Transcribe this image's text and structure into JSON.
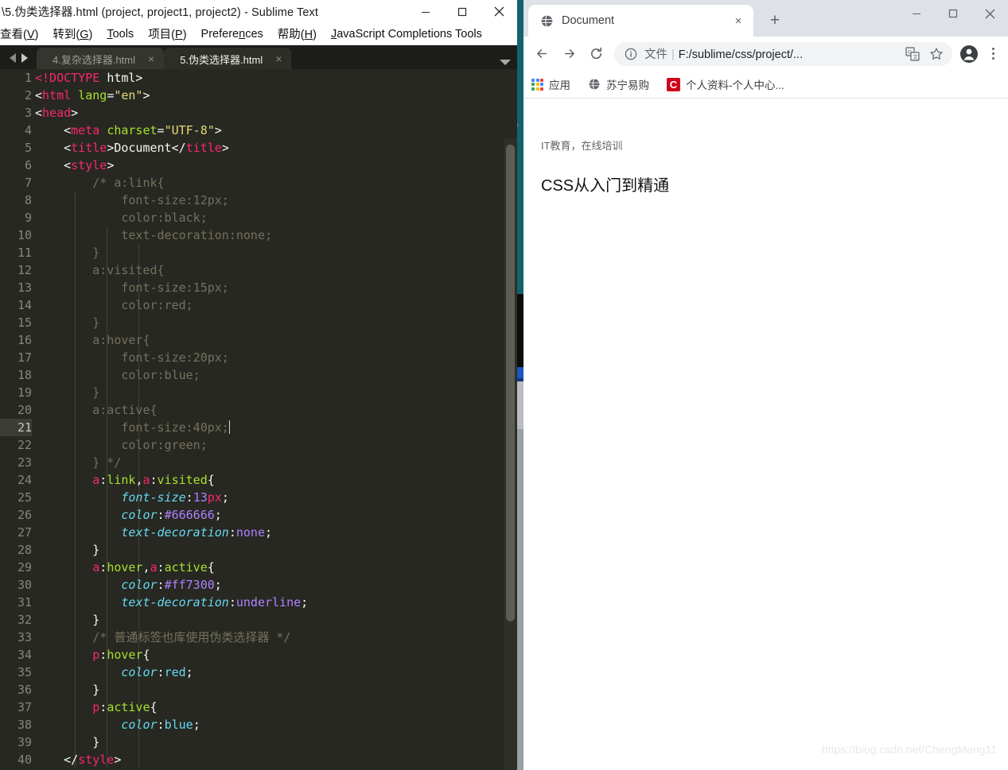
{
  "sublime": {
    "title": "\\5.伪类选择器.html (project, project1, project2) - Sublime Text",
    "window_buttons": {
      "minimize": "minimize-icon",
      "maximize": "maximize-icon",
      "close": "close-icon"
    },
    "menus": [
      {
        "label": "查看(V)",
        "mnemonic": "V"
      },
      {
        "label": "转到(G)",
        "mnemonic": "G"
      },
      {
        "label": "Tools",
        "mnemonic": "T"
      },
      {
        "label": "项目(P)",
        "mnemonic": "P"
      },
      {
        "label": "Preferences",
        "mnemonic": "n"
      },
      {
        "label": "帮助(H)",
        "mnemonic": "H"
      },
      {
        "label": "JavaScript Completions Tools",
        "mnemonic": "J"
      }
    ],
    "tabs": [
      {
        "label": "4.复杂选择器.html",
        "active": false,
        "close": "×"
      },
      {
        "label": "5.伪类选择器.html",
        "active": true,
        "close": "×"
      }
    ],
    "current_line": 21,
    "code_lines": [
      {
        "n": 1,
        "text": "<!DOCTYPE html>"
      },
      {
        "n": 2,
        "text": "<html lang=\"en\">"
      },
      {
        "n": 3,
        "text": "<head>"
      },
      {
        "n": 4,
        "text": "    <meta charset=\"UTF-8\">"
      },
      {
        "n": 5,
        "text": "    <title>Document</title>"
      },
      {
        "n": 6,
        "text": "    <style>"
      },
      {
        "n": 7,
        "text": "        /* a:link{"
      },
      {
        "n": 8,
        "text": "            font-size:12px;"
      },
      {
        "n": 9,
        "text": "            color:black;"
      },
      {
        "n": 10,
        "text": "            text-decoration:none;"
      },
      {
        "n": 11,
        "text": "        }"
      },
      {
        "n": 12,
        "text": "        a:visited{"
      },
      {
        "n": 13,
        "text": "            font-size:15px;"
      },
      {
        "n": 14,
        "text": "            color:red;"
      },
      {
        "n": 15,
        "text": "        }"
      },
      {
        "n": 16,
        "text": "        a:hover{"
      },
      {
        "n": 17,
        "text": "            font-size:20px;"
      },
      {
        "n": 18,
        "text": "            color:blue;"
      },
      {
        "n": 19,
        "text": "        }"
      },
      {
        "n": 20,
        "text": "        a:active{"
      },
      {
        "n": 21,
        "text": "            font-size:40px;"
      },
      {
        "n": 22,
        "text": "            color:green;"
      },
      {
        "n": 23,
        "text": "        } */"
      },
      {
        "n": 24,
        "text": "        a:link,a:visited{"
      },
      {
        "n": 25,
        "text": "            font-size:13px;"
      },
      {
        "n": 26,
        "text": "            color:#666666;"
      },
      {
        "n": 27,
        "text": "            text-decoration:none;"
      },
      {
        "n": 28,
        "text": "        }"
      },
      {
        "n": 29,
        "text": "        a:hover,a:active{"
      },
      {
        "n": 30,
        "text": "            color:#ff7300;"
      },
      {
        "n": 31,
        "text": "            text-decoration:underline;"
      },
      {
        "n": 32,
        "text": "        }"
      },
      {
        "n": 33,
        "text": "        /* 普通标签也库使用伪类选择器 */"
      },
      {
        "n": 34,
        "text": "        p:hover{"
      },
      {
        "n": 35,
        "text": "            color:red;"
      },
      {
        "n": 36,
        "text": "        }"
      },
      {
        "n": 37,
        "text": "        p:active{"
      },
      {
        "n": 38,
        "text": "            color:blue;"
      },
      {
        "n": 39,
        "text": "        }"
      },
      {
        "n": 40,
        "text": "    </style>"
      }
    ]
  },
  "chrome": {
    "tab": {
      "title": "Document",
      "favicon": "globe-icon",
      "close": "×"
    },
    "new_tab_label": "+",
    "window_buttons": {
      "minimize": "minimize-icon",
      "maximize": "maximize-icon",
      "close": "close-icon"
    },
    "toolbar": {
      "back": "back-arrow-icon",
      "forward": "forward-arrow-icon",
      "reload": "reload-icon",
      "site_info": "info-circle-icon",
      "url_scheme": "文件",
      "url_separator": "|",
      "url": "F:/sublime/css/project/...",
      "translate": "translate-icon",
      "bookmark": "star-icon",
      "profile": "account-avatar-icon",
      "menu": "three-dot-menu-icon"
    },
    "bookmarks": [
      {
        "label": "应用",
        "icon": "apps-grid-icon"
      },
      {
        "label": "苏宁易购",
        "icon": "globe-icon"
      },
      {
        "label": "个人资料-个人中心...",
        "icon": "c-letter-icon"
      }
    ],
    "page": {
      "link_text": "IT教育，在线培训",
      "heading_text": "CSS从入门到精通",
      "link_color": "#666666",
      "heading_color": "#111111"
    }
  },
  "watermark": "https://blog.csdn.net/ChengMeng11"
}
